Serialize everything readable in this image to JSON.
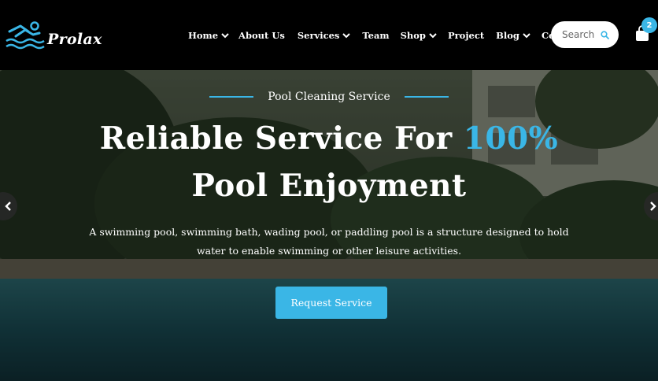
{
  "brand": {
    "name": "Prolax"
  },
  "nav": {
    "items": [
      {
        "label": "Home",
        "dropdown": true
      },
      {
        "label": "About Us",
        "dropdown": false
      },
      {
        "label": "Services",
        "dropdown": true
      },
      {
        "label": "Team",
        "dropdown": false
      },
      {
        "label": "Shop",
        "dropdown": true
      },
      {
        "label": "Project",
        "dropdown": false
      },
      {
        "label": "Blog",
        "dropdown": true
      },
      {
        "label": "Contact Us",
        "dropdown": false
      }
    ]
  },
  "search": {
    "placeholder": "Search",
    "icon": "search-icon"
  },
  "cart": {
    "icon": "shopping-bag-icon",
    "count": "2"
  },
  "hero": {
    "subtitle": "Pool Cleaning Service",
    "headline_line1_prefix": "Reliable Service For ",
    "headline_line1_accent": "100%",
    "headline_line2": "Pool Enjoyment",
    "description_line1": "A swimming pool, swimming bath, wading pool, or paddling pool is a structure designed to hold",
    "description_line2": "water to enable swimming or other leisure activities.",
    "cta_label": "Request Service",
    "prev_icon": "chevron-left-icon",
    "next_icon": "chevron-right-icon"
  },
  "colors": {
    "accent": "#3ab6e6",
    "header_bg": "#000000",
    "text": "#ffffff"
  }
}
